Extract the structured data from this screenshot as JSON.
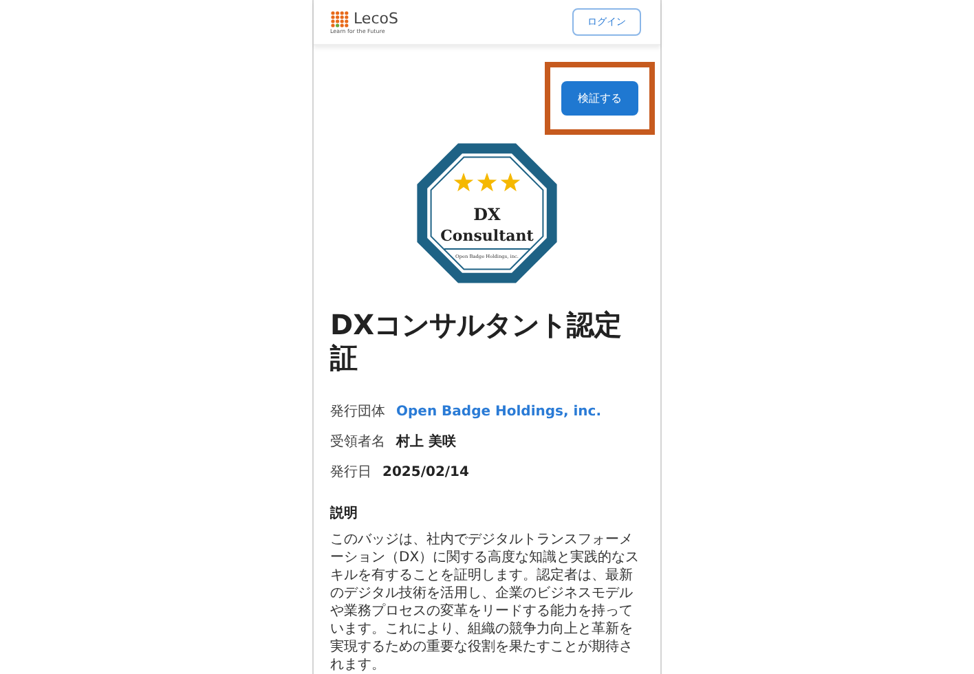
{
  "header": {
    "logo": {
      "name": "LecoS",
      "tagline": "Learn for the Future"
    },
    "login_button": "ログイン"
  },
  "verify_button": {
    "label": "検証する",
    "highlighted": true
  },
  "badge": {
    "line_1": "DX",
    "line_2": "Consultant",
    "issuer": "Open Badge Holdings, inc.",
    "stars": 3
  },
  "title": "DXコンサルタント認定証",
  "details": [
    {
      "label": "発行団体",
      "value": "Open Badge Holdings, inc.",
      "kind": "link"
    },
    {
      "label": "受領者名",
      "value": "村上 美咲",
      "kind": "text"
    },
    {
      "label": "発行日",
      "value": "2025/02/14",
      "kind": "text"
    }
  ],
  "description": {
    "heading": "説明",
    "text": "このバッジは、社内でデジタルトランスフォーメーション（DX）に関する高度な知識と実践的なスキルを有することを証明します。認定者は、最新のデジタル技術を活用し、企業のビジネスモデルや業務プロセスの変革をリードする能力を持っています。これにより、組織の競争力向上と革新を実現するための重要な役割を果たすことが期待されます。"
  }
}
